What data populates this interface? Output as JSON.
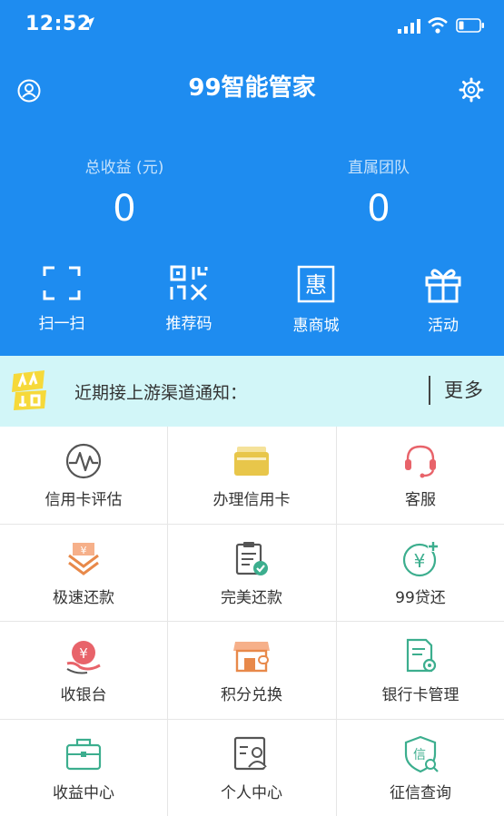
{
  "status_bar": {
    "time": "12:52"
  },
  "header": {
    "title": "99智能管家"
  },
  "stats": [
    {
      "label": "总收益 (元)",
      "value": "0"
    },
    {
      "label": "直属团队",
      "value": "0"
    }
  ],
  "quick_actions": [
    {
      "label": "扫一扫",
      "icon": "scan-icon"
    },
    {
      "label": "推荐码",
      "icon": "qr-code-icon"
    },
    {
      "label": "惠商城",
      "icon": "mall-icon"
    },
    {
      "label": "活动",
      "icon": "gift-icon"
    }
  ],
  "notice": {
    "text": "近期接上游渠道通知：",
    "more": "更多"
  },
  "grid": [
    {
      "label": "信用卡评估",
      "icon": "pulse-icon"
    },
    {
      "label": "办理信用卡",
      "icon": "card-icon"
    },
    {
      "label": "客服",
      "icon": "headset-icon"
    },
    {
      "label": "极速还款",
      "icon": "fast-repay-icon"
    },
    {
      "label": "完美还款",
      "icon": "clipboard-check-icon"
    },
    {
      "label": "99贷还",
      "icon": "yuan-loan-icon"
    },
    {
      "label": "收银台",
      "icon": "cashier-icon"
    },
    {
      "label": "积分兑换",
      "icon": "store-icon"
    },
    {
      "label": "银行卡管理",
      "icon": "bank-doc-icon"
    },
    {
      "label": "收益中心",
      "icon": "briefcase-icon"
    },
    {
      "label": "个人中心",
      "icon": "profile-card-icon"
    },
    {
      "label": "征信查询",
      "icon": "credit-shield-icon"
    }
  ],
  "colors": {
    "primary": "#1e8cf0",
    "notice_bg": "#d2f6f8",
    "icon_gray": "#555555",
    "icon_yellow": "#e8c64a",
    "icon_red": "#e8636a",
    "icon_orange": "#e8894a",
    "icon_green": "#3cae8e"
  }
}
